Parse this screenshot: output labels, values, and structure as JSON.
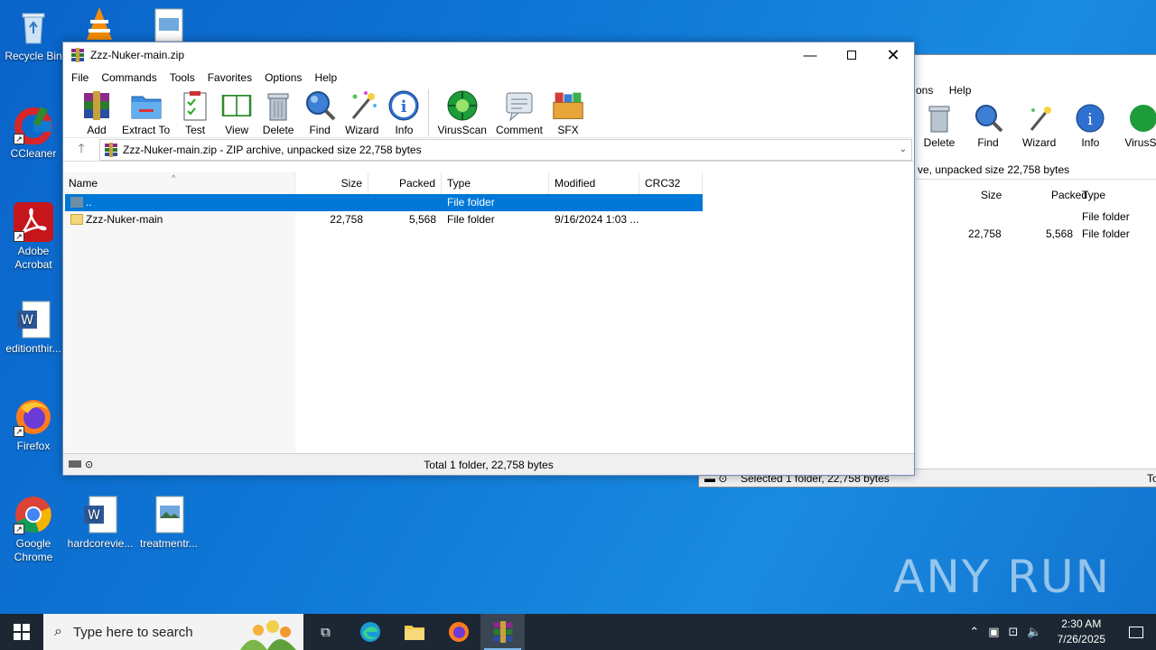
{
  "desktop": {
    "icons": [
      {
        "label": "Recycle Bin"
      },
      {
        "label": "CCleaner"
      },
      {
        "label": "Adobe Acrobat"
      },
      {
        "label": "editionthir..."
      },
      {
        "label": "Firefox"
      },
      {
        "label": "Google Chrome"
      },
      {
        "label": "hardcorevie..."
      },
      {
        "label": "treatmentr..."
      }
    ],
    "watermark": "ANY RUN"
  },
  "bg_window": {
    "menu_partial": "ons",
    "menu_help": "Help",
    "toolbar": [
      "Delete",
      "Find",
      "Wizard",
      "Info",
      "VirusSc"
    ],
    "address": "ve, unpacked size 22,758 bytes",
    "columns": {
      "size": "Size",
      "packed": "Packed",
      "type": "Type"
    },
    "rows": [
      {
        "size": "",
        "packed": "",
        "type": "File folder"
      },
      {
        "size": "22,758",
        "packed": "5,568",
        "type": "File folder"
      }
    ],
    "status": "Selected 1 folder, 22,758 bytes",
    "status_right": "To"
  },
  "window": {
    "title": "Zzz-Nuker-main.zip",
    "menu": [
      "File",
      "Commands",
      "Tools",
      "Favorites",
      "Options",
      "Help"
    ],
    "toolbar": [
      {
        "label": "Add",
        "icon": "add-archive-icon"
      },
      {
        "label": "Extract To",
        "icon": "extract-folder-icon"
      },
      {
        "label": "Test",
        "icon": "test-clipboard-icon"
      },
      {
        "label": "View",
        "icon": "view-book-icon"
      },
      {
        "label": "Delete",
        "icon": "trash-icon"
      },
      {
        "label": "Find",
        "icon": "magnifier-icon"
      },
      {
        "label": "Wizard",
        "icon": "wand-icon"
      },
      {
        "label": "Info",
        "icon": "info-icon"
      },
      {
        "label": "VirusScan",
        "icon": "virus-icon"
      },
      {
        "label": "Comment",
        "icon": "comment-icon"
      },
      {
        "label": "SFX",
        "icon": "sfx-box-icon"
      }
    ],
    "address": "Zzz-Nuker-main.zip - ZIP archive, unpacked size 22,758 bytes",
    "columns": {
      "name": "Name",
      "size": "Size",
      "packed": "Packed",
      "type": "Type",
      "modified": "Modified",
      "crc": "CRC32"
    },
    "rows": [
      {
        "name": "..",
        "size": "",
        "packed": "",
        "type": "File folder",
        "modified": "",
        "crc": ""
      },
      {
        "name": "Zzz-Nuker-main",
        "size": "22,758",
        "packed": "5,568",
        "type": "File folder",
        "modified": "9/16/2024 1:03 ...",
        "crc": ""
      }
    ],
    "status": "Total 1 folder, 22,758 bytes"
  },
  "taskbar": {
    "search_placeholder": "Type here to search",
    "time": "2:30 AM",
    "date": "7/26/2025"
  }
}
